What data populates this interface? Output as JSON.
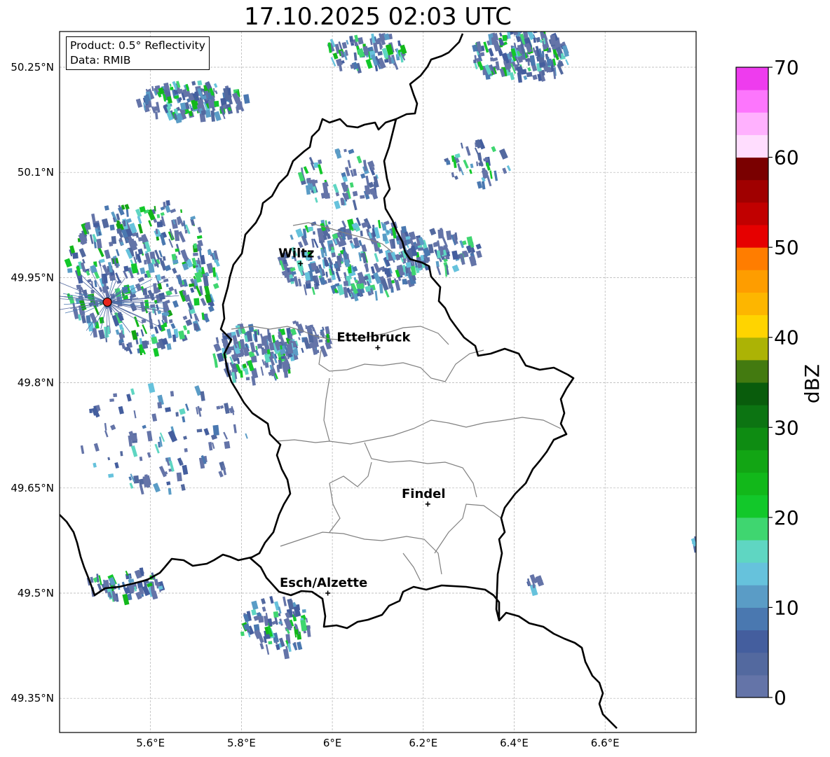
{
  "title": "17.10.2025 02:03 UTC",
  "info": {
    "product": "Product: 0.5° Reflectivity",
    "source": "Data: RMIB"
  },
  "axes": {
    "lon_range": [
      5.4,
      6.8
    ],
    "lat_range": [
      49.3,
      50.3
    ],
    "x_ticks": [
      {
        "value": 5.6,
        "label": "5.6°E"
      },
      {
        "value": 5.8,
        "label": "5.8°E"
      },
      {
        "value": 6.0,
        "label": "6°E"
      },
      {
        "value": 6.2,
        "label": "6.2°E"
      },
      {
        "value": 6.4,
        "label": "6.4°E"
      },
      {
        "value": 6.6,
        "label": "6.6°E"
      }
    ],
    "y_ticks": [
      {
        "value": 50.25,
        "label": "50.25°N"
      },
      {
        "value": 50.1,
        "label": "50.1°N"
      },
      {
        "value": 49.95,
        "label": "49.95°N"
      },
      {
        "value": 49.8,
        "label": "49.8°N"
      },
      {
        "value": 49.65,
        "label": "49.65°N"
      },
      {
        "value": 49.5,
        "label": "49.5°N"
      },
      {
        "value": 49.35,
        "label": "49.35°N"
      }
    ]
  },
  "cities": [
    {
      "name": "Wiltz",
      "lon": 5.93,
      "lat": 49.97
    },
    {
      "name": "Ettelbruck",
      "lon": 6.1,
      "lat": 49.85
    },
    {
      "name": "Findel",
      "lon": 6.21,
      "lat": 49.627
    },
    {
      "name": "Esch/Alzette",
      "lon": 5.99,
      "lat": 49.5
    }
  ],
  "radar_site": {
    "lon": 5.505,
    "lat": 49.915,
    "color": "#e8241c"
  },
  "colorbar": {
    "label": "dBZ",
    "min": 0,
    "max": 70,
    "ticks": [
      {
        "value": 0,
        "label": "0"
      },
      {
        "value": 10,
        "label": "10"
      },
      {
        "value": 20,
        "label": "20"
      },
      {
        "value": 30,
        "label": "30"
      },
      {
        "value": 40,
        "label": "40"
      },
      {
        "value": 50,
        "label": "50"
      },
      {
        "value": 60,
        "label": "60"
      },
      {
        "value": 70,
        "label": "70"
      }
    ],
    "colors": [
      "#6474a8",
      "#53699f",
      "#445e9e",
      "#4a78b0",
      "#5a9cc6",
      "#66c2dc",
      "#5fd6c2",
      "#3fd670",
      "#12c82a",
      "#12b81a",
      "#12a514",
      "#0e8c12",
      "#0c7412",
      "#095c0c",
      "#437a10",
      "#acb305",
      "#ffd400",
      "#fdb600",
      "#fe9d00",
      "#ff7d00",
      "#e60000",
      "#c10000",
      "#a00000",
      "#7a0000",
      "#ffddfe",
      "#ffb1fe",
      "#fd76fd",
      "#ee3cee"
    ]
  }
}
